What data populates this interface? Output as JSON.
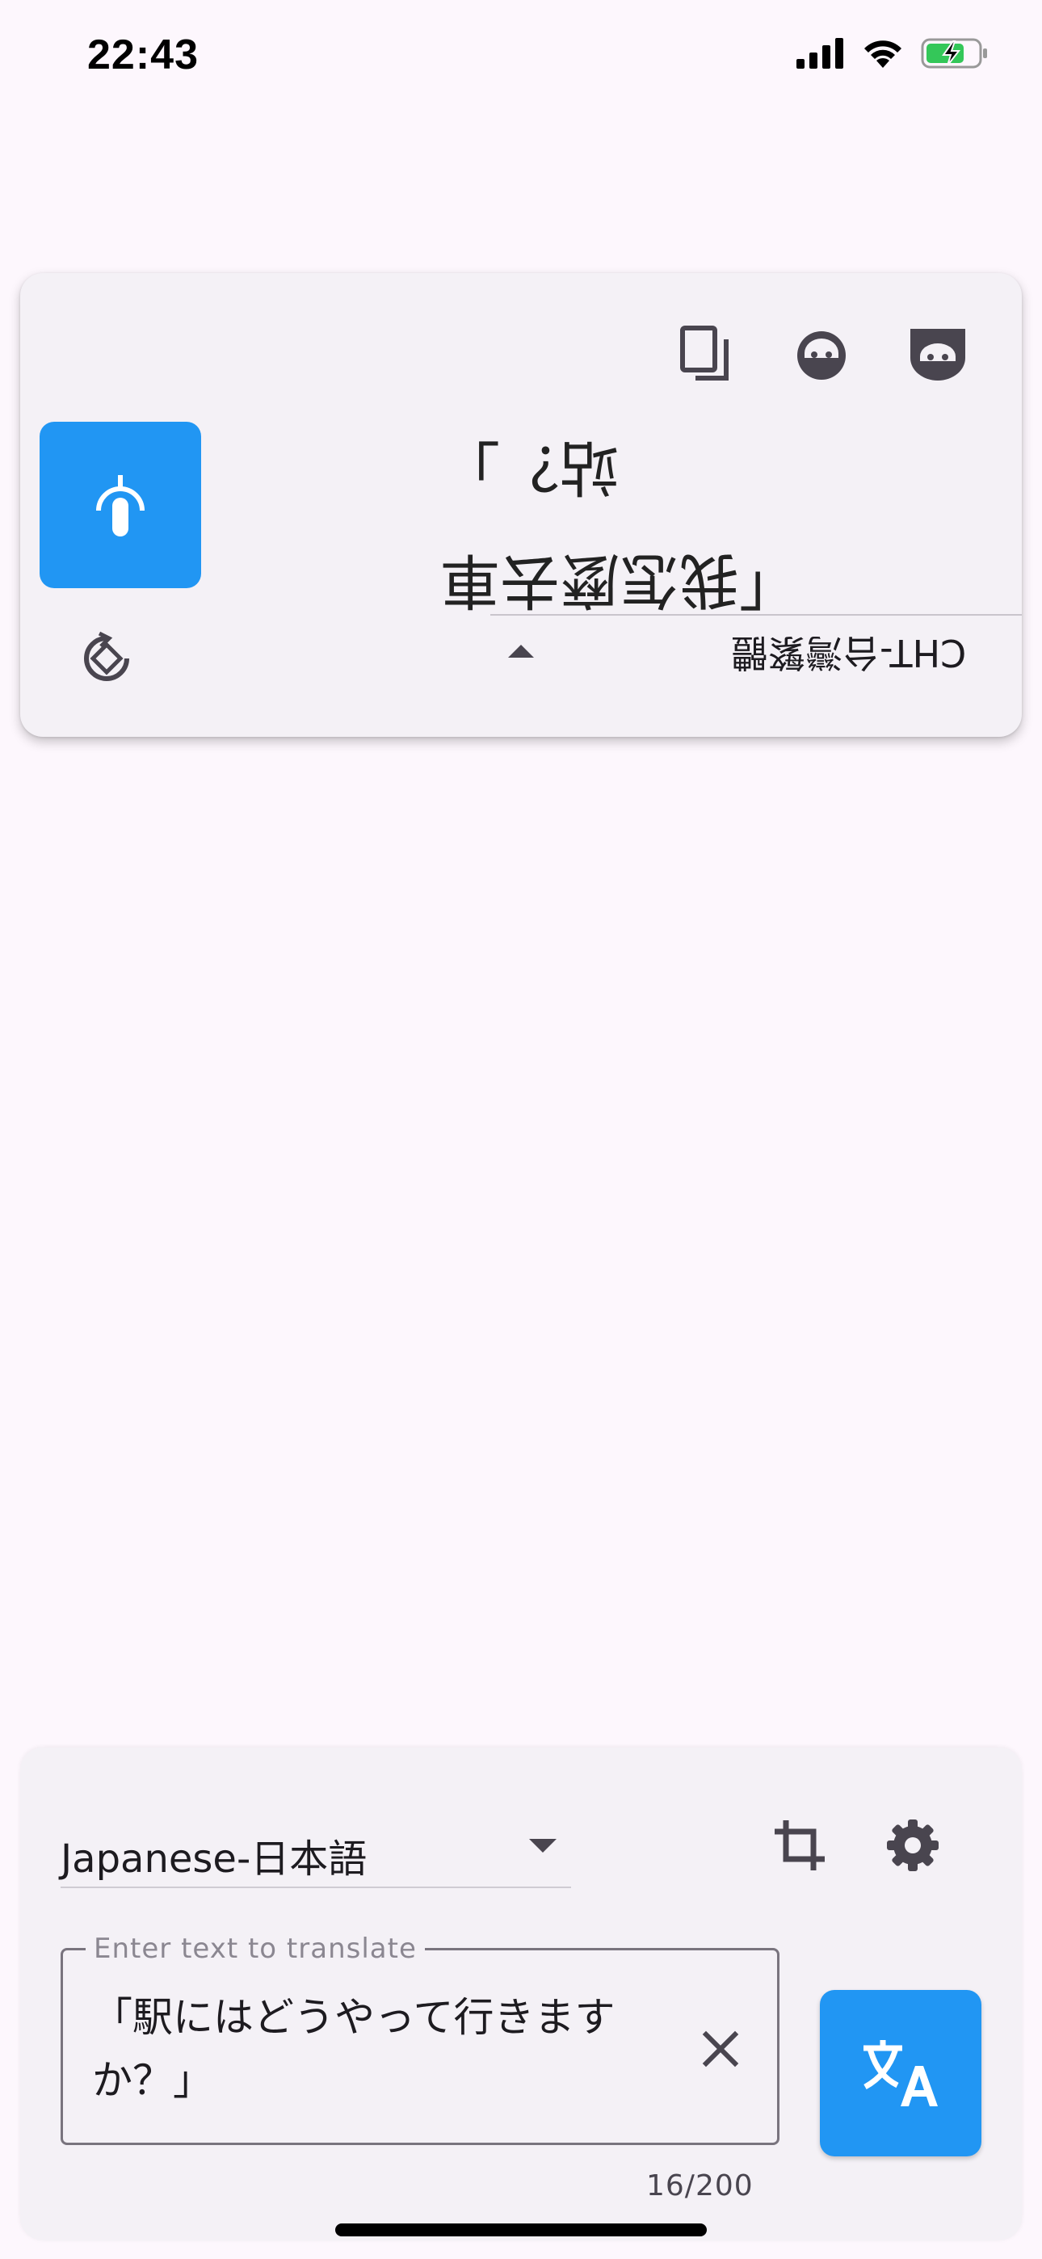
{
  "status_bar": {
    "time": "22:43",
    "icons": [
      "cellular-signal-icon",
      "wifi-icon",
      "battery-charging-icon"
    ],
    "battery_color": "#34c759"
  },
  "top_card": {
    "icons": [
      "copy-icon",
      "chat-bubble-icon",
      "chat-bubble-filled-icon",
      "mic-icon",
      "rotate-icon"
    ],
    "translated_text": "「我怎麼去車\n站？」",
    "target_language": "CHT-台灣繁體",
    "accent": "#2196f3"
  },
  "bottom_card": {
    "source_language": "Japanese-日本語",
    "icons": [
      "crop-icon",
      "settings-icon",
      "close-icon",
      "translate-icon"
    ],
    "input": {
      "label": "Enter text to translate",
      "value": "「駅にはどうやって行きますか？」"
    },
    "char_counter": "16/200"
  }
}
